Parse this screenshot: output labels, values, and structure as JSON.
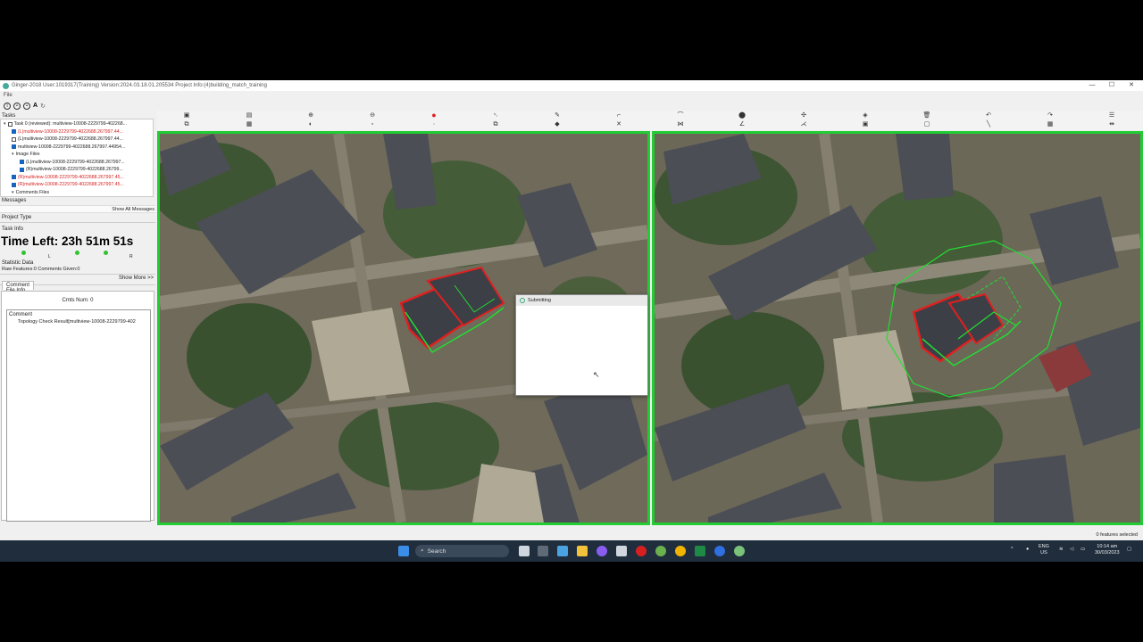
{
  "window": {
    "title": "Ginger-2018   User:1019317(Training)   Version:2024.03.18.01.205534   Project Info:(4)building_match_training",
    "menu": "File",
    "controls": [
      "—",
      "☐",
      "✕"
    ]
  },
  "left_panel": {
    "tasks_label": "Tasks",
    "tree": [
      {
        "text": "Task 0 (reviewed): multiview-10008-2229799-402268...",
        "indent": 0,
        "checked": false,
        "red": false,
        "expander": "▾"
      },
      {
        "text": "(L)multiview-10008-2229799-4022688.267997.44...",
        "indent": 1,
        "checked": true,
        "red": true,
        "expander": ""
      },
      {
        "text": "(L)multiview-10008-2229799-4022688.267997.44...",
        "indent": 1,
        "checked": false,
        "red": false,
        "expander": ""
      },
      {
        "text": "multiview-10008-2229799-4022688.267997.44954...",
        "indent": 1,
        "checked": true,
        "red": false,
        "expander": ""
      },
      {
        "text": "Image Files",
        "indent": 1,
        "checked": null,
        "red": false,
        "expander": "▾"
      },
      {
        "text": "(L)multiview-10008-2229799-4022688.267997...",
        "indent": 2,
        "checked": true,
        "red": false,
        "expander": ""
      },
      {
        "text": "(R)multiview-10008-2229799-4022688.26799...",
        "indent": 2,
        "checked": true,
        "red": false,
        "expander": ""
      },
      {
        "text": "(R)multiview-10008-2229799-4022688.267997.45...",
        "indent": 1,
        "checked": true,
        "red": true,
        "expander": ""
      },
      {
        "text": "(R)multiview-10008-2229799-4022688.267997.45...",
        "indent": 1,
        "checked": true,
        "red": true,
        "expander": ""
      },
      {
        "text": "Comments Files",
        "indent": 1,
        "checked": null,
        "red": false,
        "expander": "▾"
      }
    ],
    "messages_label": "Messages",
    "show_all_messages": "Show All Messages",
    "project_type_label": "Project Type",
    "task_info_label": "Task Info",
    "time_left": "Time Left: 23h 51m 51s",
    "dot_labels": [
      "L",
      "R"
    ],
    "statistic_label": "Statistic Data",
    "raw_features": "Raw Features:0 Comments Given:0",
    "show_more": "Show More >>",
    "comment_tab": "Comment File Info",
    "cmts_num": "Cmts Num: 0",
    "comment_header": "Comment",
    "comment_item": "Topology Check Result[multiview-10008-2229799-402"
  },
  "dialog": {
    "title": "Submitting"
  },
  "statusbar": {
    "features_selected": "0 features selected"
  },
  "taskbar": {
    "search_placeholder": "Search",
    "lang_top": "ENG",
    "lang_bottom": "US",
    "time": "10:14 am",
    "date": "30/03/2023"
  },
  "colors": {
    "map_border": "#22cc33",
    "polygon_red": "#e02020",
    "polygon_green": "#22dd33"
  },
  "icons": {
    "app": "ginger-icon",
    "toolbar": [
      "save-icon",
      "print-icon",
      "zoom-in-icon",
      "zoom-out-icon",
      "record-icon",
      "cursor-icon",
      "pen-icon",
      "line-icon",
      "arc-icon",
      "pin-icon",
      "split-icon",
      "fill-icon",
      "delete-icon",
      "undo-icon",
      "redo-icon",
      "menu-icon"
    ]
  }
}
